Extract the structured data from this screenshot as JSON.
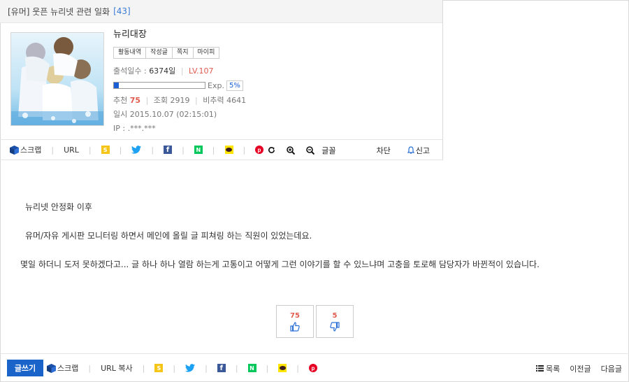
{
  "post": {
    "category": "[유머]",
    "title": "웃픈 뉴리넷 관련 일화",
    "comment_count": "[43]"
  },
  "author": {
    "nickname": "뉴리대장",
    "buttons": [
      "활동내역",
      "작성글",
      "쪽지",
      "마이피"
    ],
    "attendance_label": "출석일수 :",
    "attendance_value": "6374일",
    "level": "LV.107",
    "exp_label": "Exp.",
    "exp_percent_label": "5%",
    "exp_progress": 0.05,
    "recommend_label": "추천",
    "recommend_value": "75",
    "views_label": "조회",
    "views_value": "2919",
    "nonrec_label": "비추력",
    "nonrec_value": "4641",
    "date": "일시 2015.10.07 (02:15:01)",
    "ip": "IP : .***.***"
  },
  "share": {
    "scrap": "스크랩",
    "url": "URL",
    "font": "글꼴",
    "block": "차단",
    "report": "신고"
  },
  "article": {
    "lines": [
      "뉴리넷 안정화 이후",
      "유머/자유 게시판 모니터링 하면서 메인에 올릴 글 피쳐링 하는 직원이 있었는데요.",
      "몇일 하더니 도저 못하겠다고... 글 하나 하나 열람 하는게 고통이고 어떻게 그런 이야기를 할 수 있느냐며 고충을 토로해 담당자가 바뀐적이 있습니다."
    ]
  },
  "votes": {
    "up": "75",
    "down": "5"
  },
  "bottom": {
    "write": "글쓰기",
    "scrap": "스크랩",
    "url_copy": "URL 복사",
    "list": "목록",
    "prev": "이전글",
    "next": "다음글"
  },
  "colors": {
    "accent_blue": "#1a63c9",
    "red": "#e05a4e",
    "twitter": "#1da1f2",
    "facebook": "#3b5998",
    "naver": "#03c75a",
    "kakao": "#fee500",
    "pinterest": "#e60023"
  }
}
